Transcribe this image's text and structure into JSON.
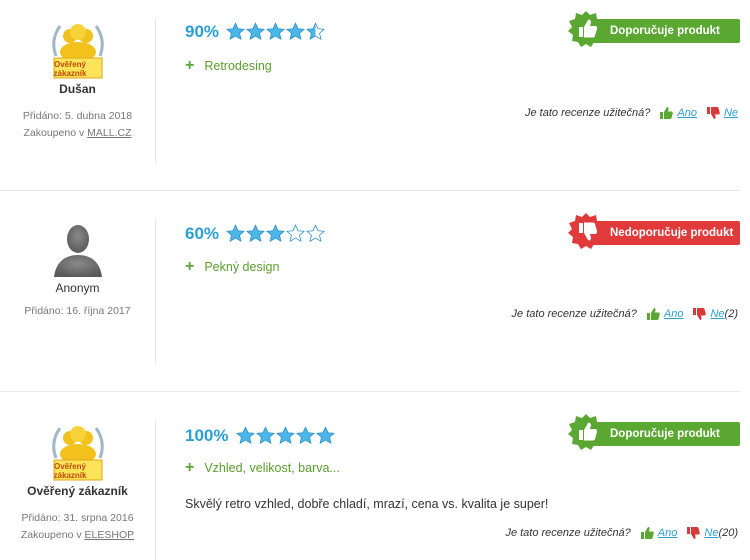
{
  "reviews": [
    {
      "author_name": "Dušan",
      "author_badge": "Ověřený zákazník",
      "added": "Přidáno: 5. dubna 2018",
      "bought_prefix": "Zakoupeno v ",
      "bought_shop": "MALL.CZ",
      "percent": "90%",
      "rating_stars": 4.5,
      "pro": "Retrodesing",
      "recommendation": "Doporučuje produkt",
      "helpful_q": "Je tato recenze užitečná?",
      "yes": "Ano",
      "no": "Ne",
      "no_count": ""
    },
    {
      "author_name": "Anonym",
      "added": "Přidáno: 16. října 2017",
      "percent": "60%",
      "rating_stars": 3,
      "pro": "Pekný design",
      "recommendation": "Nedoporučuje produkt",
      "helpful_q": "Je tato recenze užitečná?",
      "yes": "Ano",
      "no": "Ne",
      "no_count": "(2)"
    },
    {
      "author_name": "Ověřený zákazník",
      "author_badge": "Ověřený zákazník",
      "added": "Přidáno: 31. srpna 2016",
      "bought_prefix": "Zakoupeno v ",
      "bought_shop": "ELESHOP",
      "percent": "100%",
      "rating_stars": 5,
      "pro": "Vzhled, velikost, barva...",
      "text": "Skvělý retro vzhled, dobře chladí, mrazí, cena vs. kvalita je super!",
      "recommendation": "Doporučuje produkt",
      "helpful_q": "Je tato recenze užitečná?",
      "yes": "Ano",
      "no": "Ne",
      "no_count": "(20)"
    }
  ],
  "colors": {
    "green": "#5aa832",
    "red": "#e03a3a",
    "blue": "#2b9fd4",
    "star": "#4db6e8"
  }
}
